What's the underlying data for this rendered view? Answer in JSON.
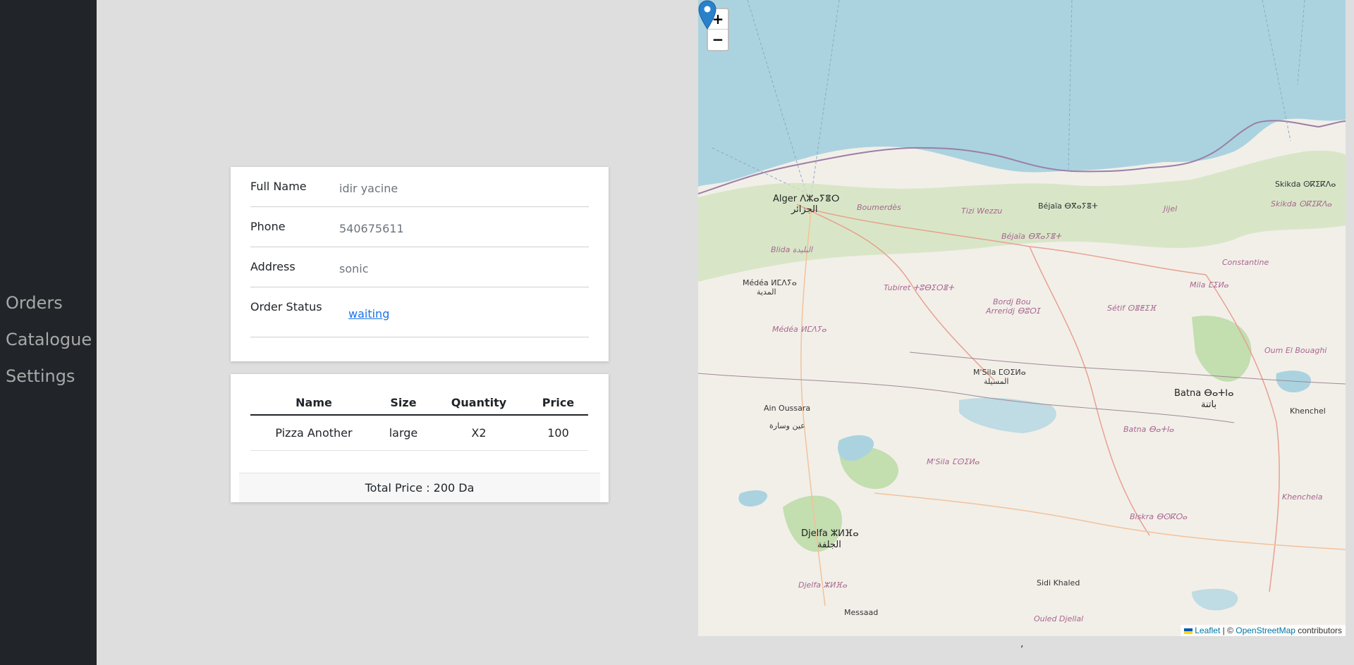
{
  "sidebar": {
    "items": [
      {
        "label": "Orders"
      },
      {
        "label": "Catalogue"
      },
      {
        "label": "Settings"
      }
    ]
  },
  "order": {
    "full_name_label": "Full Name",
    "full_name": "idir yacine",
    "phone_label": "Phone",
    "phone": "540675611",
    "address_label": "Address",
    "address": "sonic",
    "status_label": "Order Status",
    "status": "waiting"
  },
  "items_table": {
    "headers": [
      "Name",
      "Size",
      "Quantity",
      "Price"
    ],
    "rows": [
      [
        "Pizza Another",
        "large",
        "X2",
        "100"
      ]
    ],
    "total": "Total Price : 200 Da"
  },
  "map": {
    "zoom_in": "+",
    "zoom_out": "−",
    "attribution_leaflet": "Leaflet",
    "attribution_sep": " | © ",
    "attribution_osm": "OpenStreetMap",
    "attribution_suffix": " contributors",
    "labels": [
      {
        "name": "alger",
        "text": "Alger ⴷⵣⴰⵢⴻⵔ"
      },
      {
        "name": "alger-ar",
        "text": "الجزائر"
      },
      {
        "name": "boumerdes",
        "text": "Boumerdès"
      },
      {
        "name": "tizi-wezzu",
        "text": "Tizi Wezzu"
      },
      {
        "name": "bejaia",
        "text": "Béjaïa ⴱⴳⴰⵢⴻⵜ"
      },
      {
        "name": "bejaia2",
        "text": "Béjaïa ⴱⴳⴰⵢⴻⵜ"
      },
      {
        "name": "jijel",
        "text": "Jijel"
      },
      {
        "name": "skikda",
        "text": "Skikda ⵙⴽⵉⴽⴷⴰ"
      },
      {
        "name": "skikda2",
        "text": "Skikda ⵙⴽⵉⴽⴷⴰ"
      },
      {
        "name": "blida",
        "text": "Blida البليدة"
      },
      {
        "name": "medea",
        "text": "Médéa ⵍⵎⴷⵢⴰ"
      },
      {
        "name": "medea-ar",
        "text": "المدية"
      },
      {
        "name": "medea2",
        "text": "Médéa ⵍⵎⴷⵢⴰ"
      },
      {
        "name": "tubiret",
        "text": "Tubiret ⵜⵓⴱⵉⵔⴻⵜ"
      },
      {
        "name": "bordj",
        "text": "Bordj Bou"
      },
      {
        "name": "bordj2",
        "text": "Arreridj ⴱⵓⵔⵊ"
      },
      {
        "name": "setif",
        "text": "Sétif ⵙⴻⵟⵉⴼ"
      },
      {
        "name": "constantine",
        "text": "Constantine"
      },
      {
        "name": "mila",
        "text": "Mila ⵎⵉⵍⴰ"
      },
      {
        "name": "msila",
        "text": "M'Sila ⵎⵙⵉⵍⴰ"
      },
      {
        "name": "msila-ar",
        "text": "المسيلة"
      },
      {
        "name": "msila2",
        "text": "M'Sila ⵎⵙⵉⵍⴰ"
      },
      {
        "name": "oum-el-bouaghi",
        "text": "Oum El Bouaghi"
      },
      {
        "name": "batna",
        "text": "Batna ⴱⴰⵜⵏⴰ"
      },
      {
        "name": "batna-ar",
        "text": "باتنة"
      },
      {
        "name": "batna2",
        "text": "Batna ⴱⴰⵜⵏⴰ"
      },
      {
        "name": "khenchel",
        "text": "Khenchel"
      },
      {
        "name": "ain-oussara",
        "text": "Ain Oussara"
      },
      {
        "name": "ain-oussara-ar",
        "text": "عين وسارة"
      },
      {
        "name": "djelfa",
        "text": "Djelfa ⵣⵍⴼⴰ"
      },
      {
        "name": "djelfa-ar",
        "text": "الجلفة"
      },
      {
        "name": "djelfa2",
        "text": "Djelfa ⵣⵍⴼⴰ"
      },
      {
        "name": "biskra",
        "text": "Biskra ⴱⵙⴽⵔⴰ"
      },
      {
        "name": "khenchela",
        "text": "Khenchela"
      },
      {
        "name": "sidi-khaled",
        "text": "Sidi Khaled"
      },
      {
        "name": "messaad",
        "text": "Messaad"
      },
      {
        "name": "ouled-djellal",
        "text": "Ouled Djellal"
      }
    ]
  },
  "footer_mark": ","
}
